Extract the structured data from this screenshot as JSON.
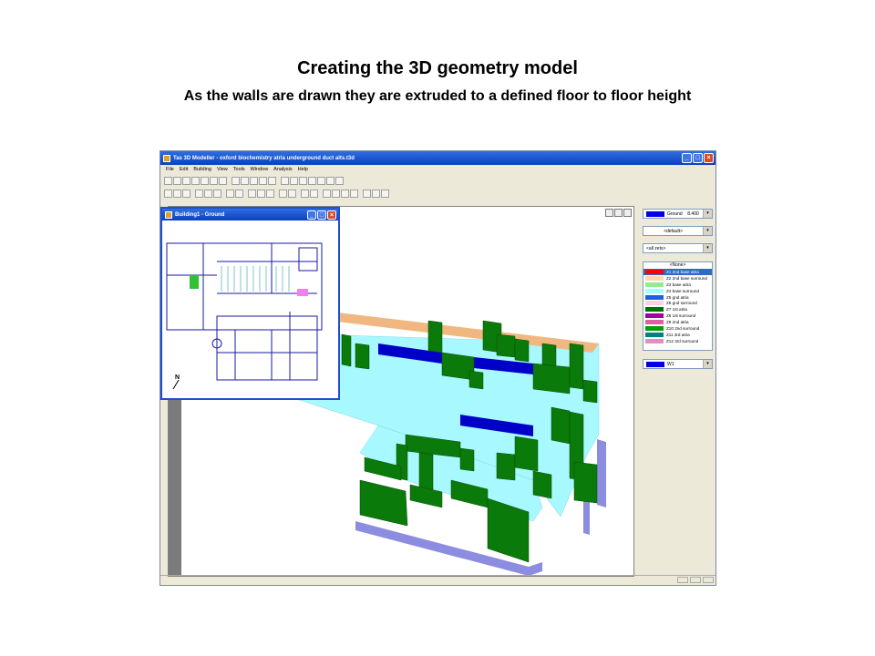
{
  "slide": {
    "title": "Creating the 3D geometry model",
    "subtitle": "As the walls are drawn they are extruded to a defined floor to floor height"
  },
  "app": {
    "title": "Tas 3D Modeller - oxford biochemistry atria underground duct alts.t3d",
    "menu": [
      "File",
      "Edit",
      "Building",
      "View",
      "Tools",
      "Window",
      "Analysis",
      "Help"
    ]
  },
  "child_window": {
    "title": "Building1 - Ground",
    "north_label": "N"
  },
  "panel": {
    "floor_combo": {
      "label": "Ground",
      "value": "8.400",
      "color": "#0000e0"
    },
    "default_combo": "<default>",
    "zonesets_combo": "<all zets>",
    "zone_list": {
      "none_label": "<None>",
      "items": [
        {
          "label": "Z1 2nd base atria",
          "color": "#ff0000",
          "selected": true
        },
        {
          "label": "Z2 2nd base surround",
          "color": "#ffd8b0",
          "selected": false
        },
        {
          "label": "Z3 base atria",
          "color": "#90ee90",
          "selected": false
        },
        {
          "label": "Z4 base surround",
          "color": "#a0ffff",
          "selected": false
        },
        {
          "label": "Z5 gnd atria",
          "color": "#2060e0",
          "selected": false
        },
        {
          "label": "Z6 gnd surround",
          "color": "#ffd0e0",
          "selected": false
        },
        {
          "label": "Z7 1st atria",
          "color": "#007000",
          "selected": false
        },
        {
          "label": "Z8 1st surround",
          "color": "#a000a0",
          "selected": false
        },
        {
          "label": "Z9 2nd atria",
          "color": "#e060a0",
          "selected": false
        },
        {
          "label": "Z10 2nd surround",
          "color": "#00a000",
          "selected": false
        },
        {
          "label": "Z11 3rd atria",
          "color": "#008080",
          "selected": false
        },
        {
          "label": "Z12 3rd surround",
          "color": "#e090c0",
          "selected": false
        }
      ]
    },
    "wall_combo": {
      "label": "W1",
      "color": "#0000e0"
    }
  },
  "colors": {
    "wall_green": "#0a7a0a",
    "floor_cyan": "#a8f8ff",
    "wall_side_purple": "#8c8ce0",
    "window_blue": "#0000c8",
    "top_orange": "#f0b880"
  }
}
